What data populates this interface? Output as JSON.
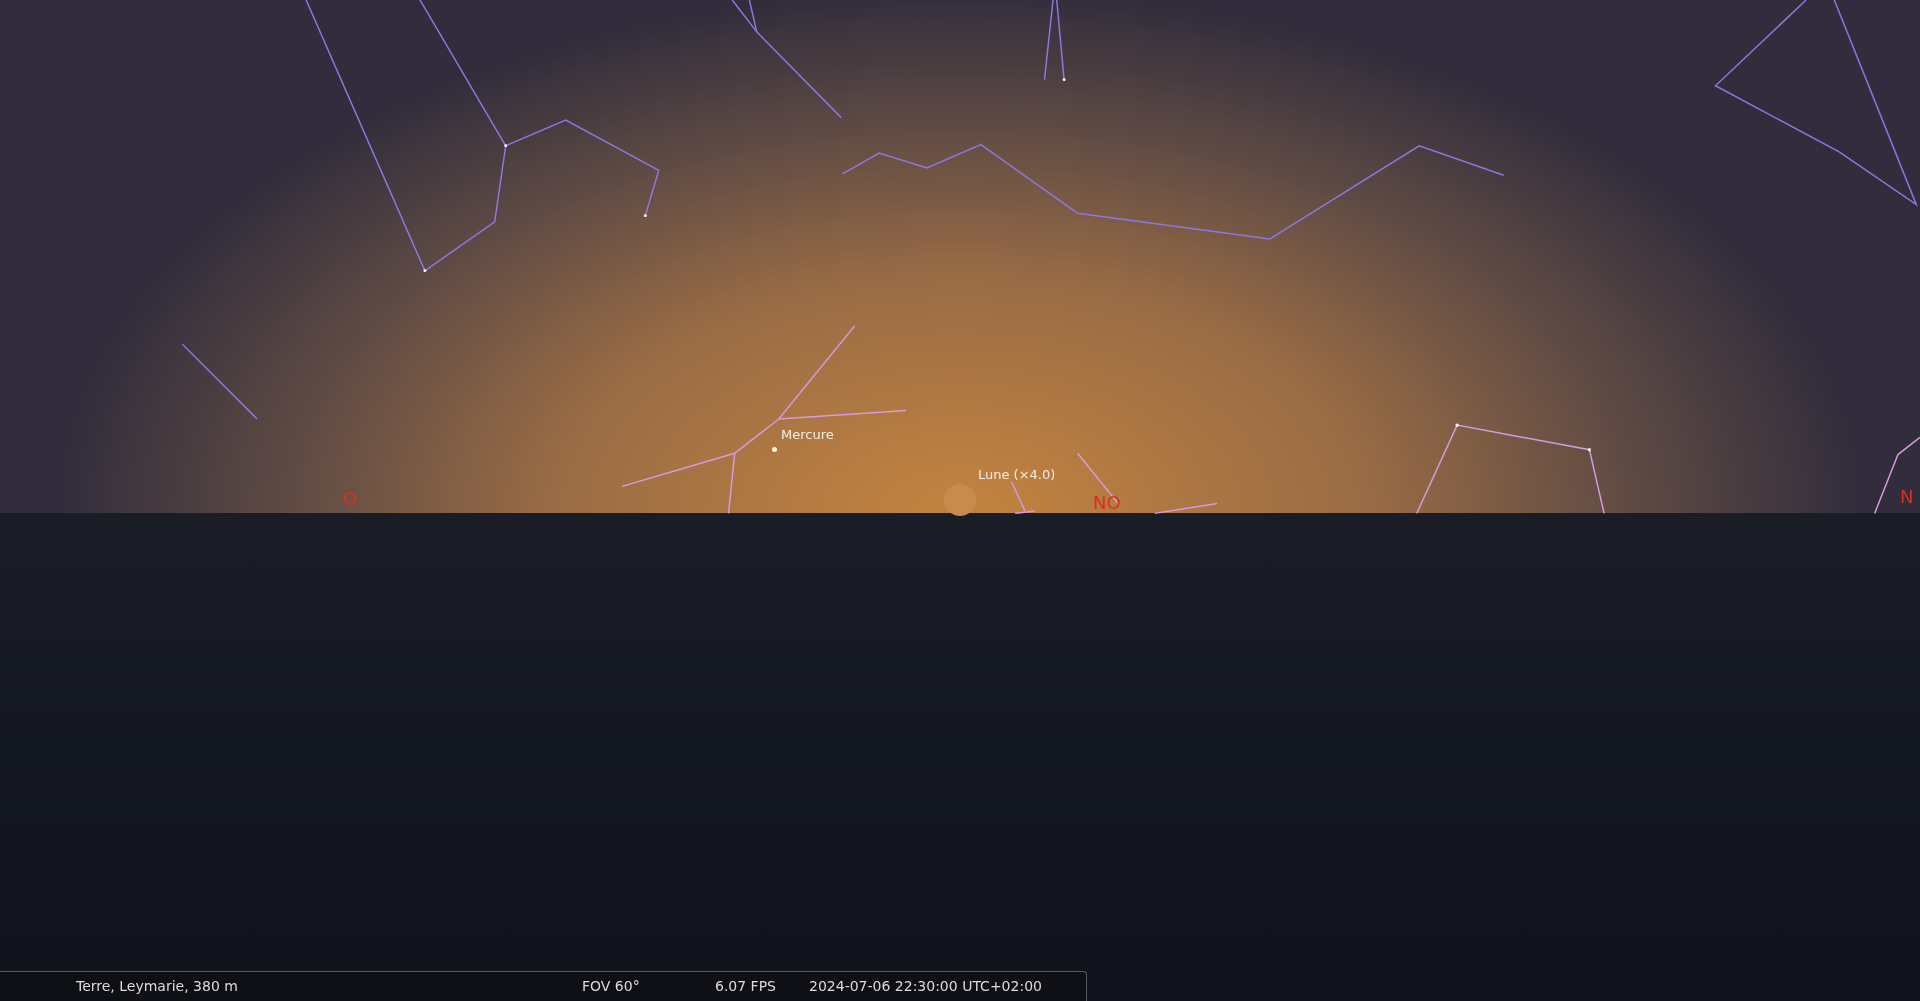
{
  "sky": {
    "objects": [
      {
        "kind": "planet",
        "label": "Mercure"
      },
      {
        "kind": "moon",
        "label": "Lune (×4.0)"
      }
    ],
    "cardinals": [
      "O",
      "NO",
      "N"
    ]
  },
  "status_bar": {
    "location": "Terre, Leymarie, 380 m",
    "fov": "FOV 60°",
    "fps": "6.07 FPS",
    "datetime": "2024-07-06 22:30:00 UTC+02:00"
  }
}
